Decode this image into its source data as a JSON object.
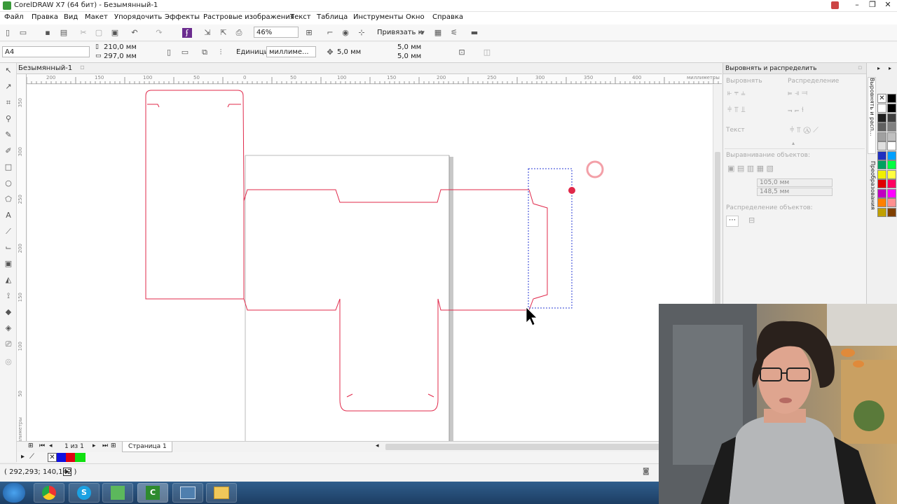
{
  "window": {
    "title": "CorelDRAW X7 (64 бит) - Безымянный-1"
  },
  "menu": [
    "Файл",
    "Правка",
    "Вид",
    "Макет",
    "Упорядочить",
    "Эффекты",
    "Растровые изображения",
    "Текст",
    "Таблица",
    "Инструменты",
    "Окно",
    "Справка"
  ],
  "toolbar": {
    "zoom": "46%",
    "snap_label": "Привязать к"
  },
  "propbar": {
    "page_size": "A4",
    "width": "210,0 мм",
    "height": "297,0 мм",
    "units_label": "Единицы:",
    "units_value": "миллиме...",
    "nudge": "5,0 мм",
    "dup_x": "5,0 мм",
    "dup_y": "5,0 мм"
  },
  "document": {
    "tab": "Безымянный-1",
    "ruler_top_ticks": [
      "200",
      "150",
      "100",
      "50",
      "0",
      "50",
      "100",
      "150",
      "200",
      "250",
      "300",
      "350",
      "400"
    ],
    "ruler_top_unit": "миллиметры",
    "ruler_left_ticks": [
      "350",
      "300",
      "250",
      "200",
      "150",
      "100",
      "50"
    ],
    "ruler_left_unit": "миллиметры"
  },
  "pagenav": {
    "page_count": "1 из 1",
    "page_tab": "Страница 1"
  },
  "status": {
    "coords": "( 292,293; 140,142 )"
  },
  "docker": {
    "title": "Выровнять и распределить",
    "align_label": "Выровнять",
    "distribute_label": "Распределение",
    "text_label": "Текст",
    "align_objects_label": "Выравнивание объектов:",
    "x_value": "105,0 мм",
    "y_value": "148,5 мм",
    "distribute_objects_label": "Распределение объектов:",
    "side_tab_1": "Выровнять и расп...",
    "side_tab_2": "Преобразования"
  },
  "colors": {
    "dieline": "#e0284a",
    "selection": "#2a3bd4",
    "palette": [
      "#ffffff",
      "#000000",
      "#202020",
      "#404040",
      "#606060",
      "#808080",
      "#a0a0a0",
      "#c0c0c0",
      "#e0e0e0",
      "#ffffff",
      "#2030c0",
      "#00a0ff",
      "#00a060",
      "#00ff40",
      "#f0f000",
      "#ffff40",
      "#e00000",
      "#ff0060",
      "#c000c0",
      "#ff00ff",
      "#ff8000",
      "#ff9090",
      "#c0a000",
      "#804000"
    ]
  },
  "taskbar_apps": [
    "start-button",
    "chrome-icon",
    "skype-icon",
    "corel-connect-icon",
    "coreldraw-icon",
    "photo-icon",
    "explorer-icon"
  ]
}
